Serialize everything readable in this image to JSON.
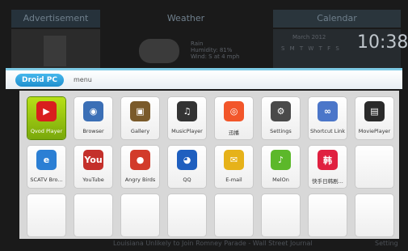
{
  "background": {
    "tabs": {
      "ad": "Advertisement",
      "weather": "Weather",
      "calendar": "Calendar"
    },
    "weather_lines": [
      "Rain",
      "Humidity: 81%",
      "Wind: S at 4 mph"
    ],
    "calendar_month": "March 2012",
    "calendar_days": "S M T W T F S",
    "clock": "10:38",
    "ticker": "Louisiana Unlikely to Join Romney Parade - Wall Street Journal",
    "setting": "Setting"
  },
  "header": {
    "pill": "Droid PC",
    "label": "menu"
  },
  "apps": [
    {
      "label": "Qvod Player",
      "color": "#d91e1e",
      "glyph": "▶",
      "selected": true
    },
    {
      "label": "Browser",
      "color": "#3b6fb6",
      "glyph": "◉",
      "selected": false
    },
    {
      "label": "Gallery",
      "color": "#7a5a2a",
      "glyph": "▣",
      "selected": false
    },
    {
      "label": "MusicPlayer",
      "color": "#333333",
      "glyph": "♫",
      "selected": false
    },
    {
      "label": "迅播",
      "color": "#f2562a",
      "glyph": "◎",
      "selected": false
    },
    {
      "label": "Settings",
      "color": "#4a4a4a",
      "glyph": "⚙",
      "selected": false
    },
    {
      "label": "Shortcut Link",
      "color": "#4b76c9",
      "glyph": "∞",
      "selected": false
    },
    {
      "label": "MoviePlayer",
      "color": "#2a2a2a",
      "glyph": "▤",
      "selected": false
    },
    {
      "label": "SCATV Bro...",
      "color": "#2b7fd4",
      "glyph": "e",
      "selected": false
    },
    {
      "label": "YouTube",
      "color": "#c4302b",
      "glyph": "You",
      "selected": false
    },
    {
      "label": "Angry Birds",
      "color": "#d23b2a",
      "glyph": "●",
      "selected": false
    },
    {
      "label": "QQ",
      "color": "#1f5fbf",
      "glyph": "◕",
      "selected": false
    },
    {
      "label": "E-mail",
      "color": "#e6b21a",
      "glyph": "✉",
      "selected": false
    },
    {
      "label": "MelOn",
      "color": "#5cb82a",
      "glyph": "♪",
      "selected": false
    },
    {
      "label": "快手日韩剧...",
      "color": "#e02040",
      "glyph": "韩",
      "selected": false
    },
    {
      "label": "",
      "color": "",
      "glyph": "",
      "selected": false
    },
    {
      "label": "",
      "color": "",
      "glyph": "",
      "selected": false
    },
    {
      "label": "",
      "color": "",
      "glyph": "",
      "selected": false
    },
    {
      "label": "",
      "color": "",
      "glyph": "",
      "selected": false
    },
    {
      "label": "",
      "color": "",
      "glyph": "",
      "selected": false
    },
    {
      "label": "",
      "color": "",
      "glyph": "",
      "selected": false
    },
    {
      "label": "",
      "color": "",
      "glyph": "",
      "selected": false
    },
    {
      "label": "",
      "color": "",
      "glyph": "",
      "selected": false
    },
    {
      "label": "",
      "color": "",
      "glyph": "",
      "selected": false
    }
  ]
}
